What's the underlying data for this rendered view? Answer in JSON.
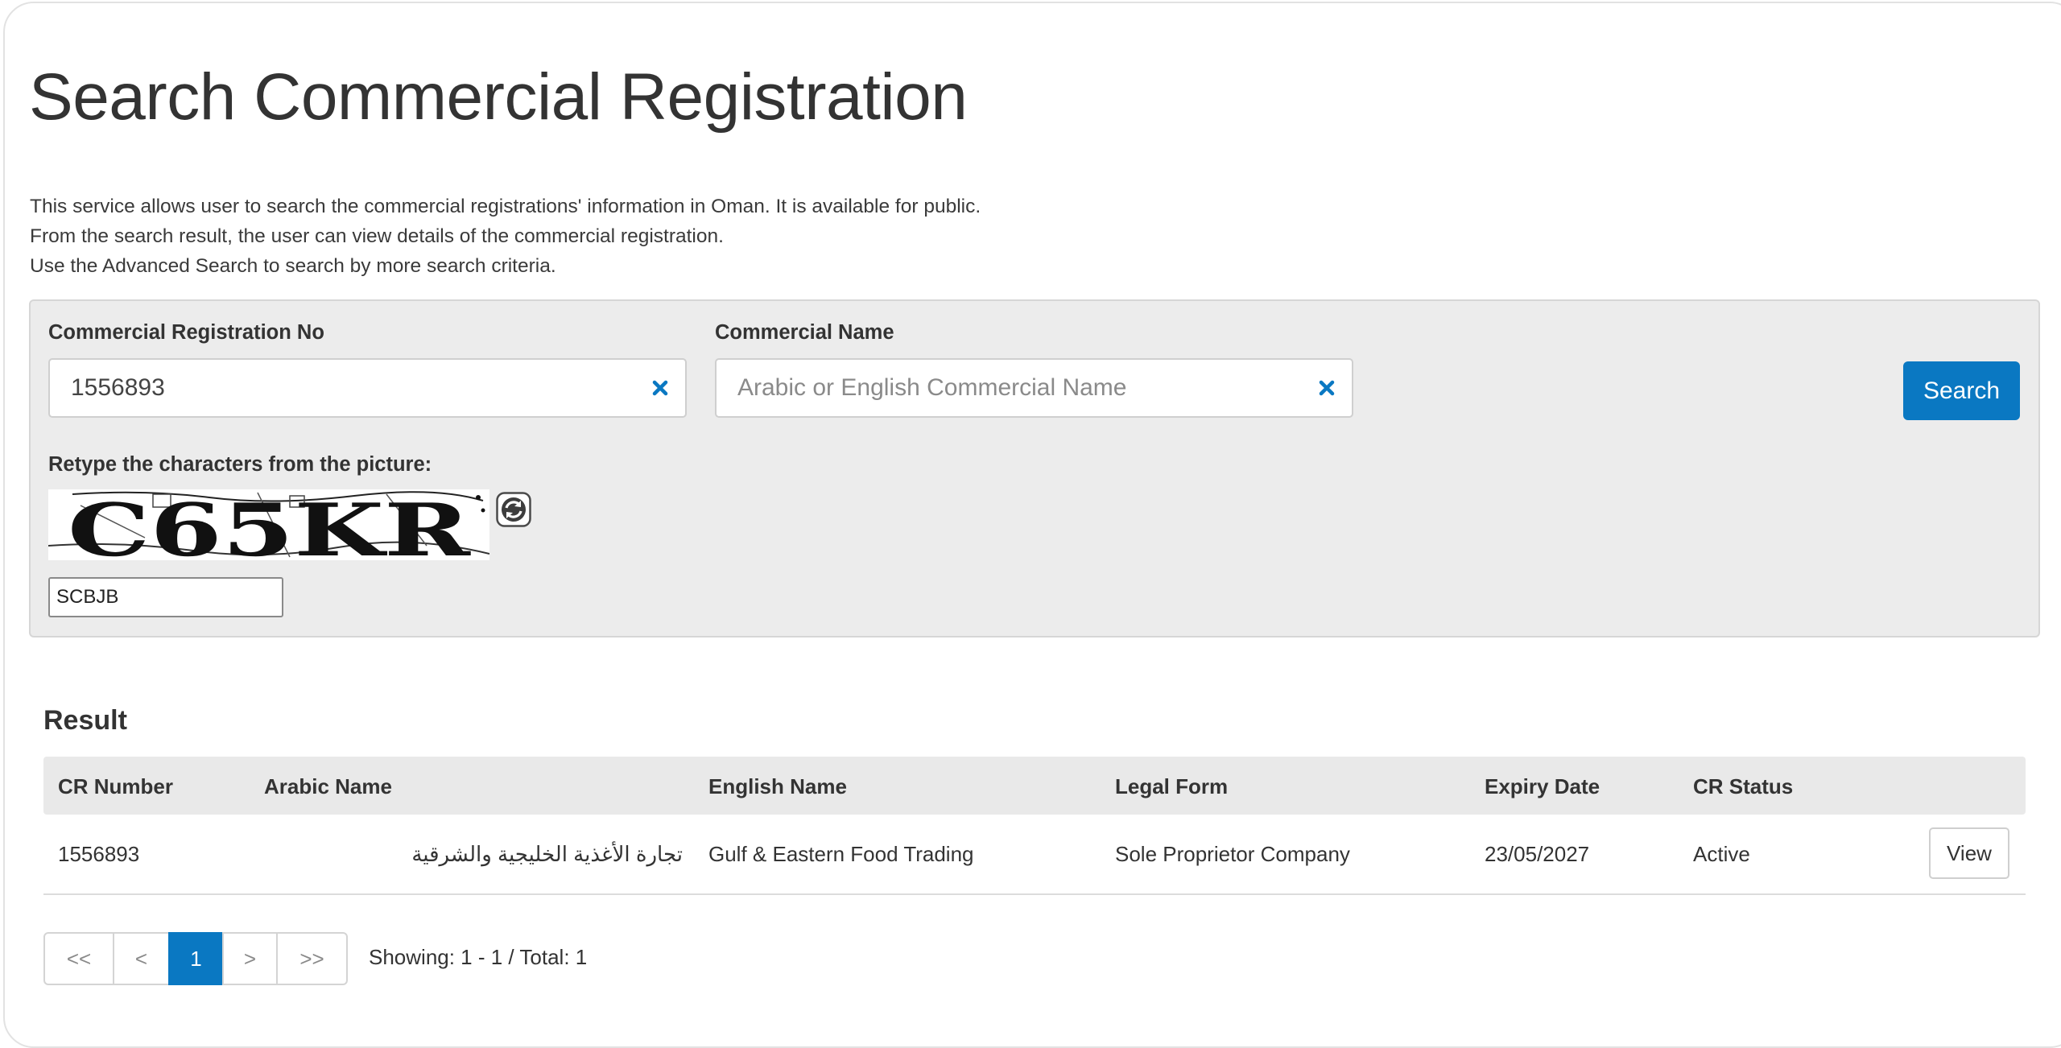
{
  "page": {
    "title": "Search Commercial Registration",
    "description": [
      "This service allows user to search the commercial registrations' information in Oman. It is available for public.",
      "From the search result, the user can view details of the commercial registration.",
      "Use the Advanced Search to search by more search criteria."
    ]
  },
  "search": {
    "cr_no_label": "Commercial Registration No",
    "cr_no_value": "1556893",
    "commercial_name_label": "Commercial Name",
    "commercial_name_value": "",
    "commercial_name_placeholder": "Arabic or English Commercial Name",
    "search_button_label": "Search",
    "captcha_label": "Retype the characters from the picture:",
    "captcha_image_text": "C65KR",
    "captcha_input_value": "SCBJB"
  },
  "result": {
    "heading": "Result",
    "columns": [
      "CR Number",
      "Arabic Name",
      "English Name",
      "Legal Form",
      "Expiry Date",
      "CR Status"
    ],
    "rows": [
      {
        "cr_number": "1556893",
        "arabic_name": "تجارة الأغذية الخليجية والشرقية",
        "english_name": "Gulf & Eastern Food Trading",
        "legal_form": "Sole Proprietor Company",
        "expiry_date": "23/05/2027",
        "cr_status": "Active",
        "action_label": "View"
      }
    ]
  },
  "pagination": {
    "first": "<<",
    "prev": "<",
    "current": "1",
    "next": ">",
    "last": ">>",
    "summary": "Showing: 1 - 1  /  Total: 1"
  },
  "colors": {
    "primary": "#0a78c2",
    "panel_background": "#ececec",
    "header_background": "#e9e9e9"
  },
  "icons": {
    "clear": "close-x-icon",
    "refresh": "refresh-icon"
  }
}
